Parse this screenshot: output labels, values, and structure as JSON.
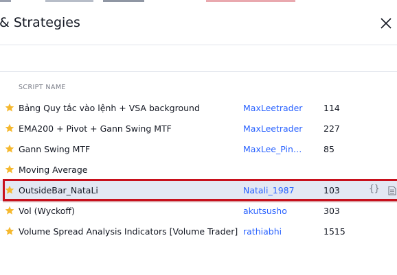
{
  "dialog": {
    "title": "& Strategies",
    "column_header": "SCRIPT NAME"
  },
  "colors": {
    "star": "#f5b82e",
    "author_link": "#2962ff",
    "highlight_border": "#c8101c",
    "selected_row": "#e3e8f3"
  },
  "rows": [
    {
      "name": "Bảng Quy tắc vào lệnh + VSA background",
      "author": "MaxLeetrader",
      "likes": "114"
    },
    {
      "name": "EMA200 + Pivot + Gann Swing MTF",
      "author": "MaxLeetrader",
      "likes": "227"
    },
    {
      "name": "Gann Swing MTF",
      "author": "MaxLee_PingP...",
      "likes": "85"
    },
    {
      "name": "Moving Average",
      "author": "",
      "likes": ""
    },
    {
      "name": "OutsideBar_NataLi",
      "author": "Natali_1987",
      "likes": "103",
      "actions": [
        "code-icon",
        "doc-icon"
      ]
    },
    {
      "name": "Vol (Wyckoff)",
      "author": "akutsusho",
      "likes": "303"
    },
    {
      "name": "Volume Spread Analysis Indicators [Volume Trader]",
      "author": "rathiabhi",
      "likes": "1515"
    }
  ],
  "code_icon_glyph": "{}"
}
